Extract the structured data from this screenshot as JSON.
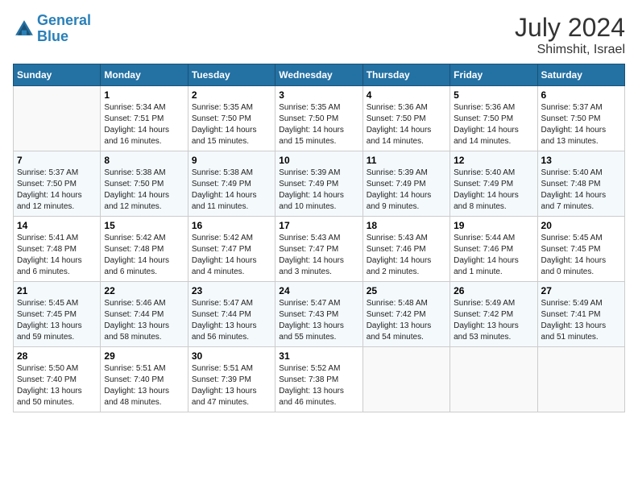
{
  "header": {
    "logo_line1": "General",
    "logo_line2": "Blue",
    "month_year": "July 2024",
    "location": "Shimshit, Israel"
  },
  "weekdays": [
    "Sunday",
    "Monday",
    "Tuesday",
    "Wednesday",
    "Thursday",
    "Friday",
    "Saturday"
  ],
  "weeks": [
    [
      {
        "day": "",
        "info": ""
      },
      {
        "day": "1",
        "info": "Sunrise: 5:34 AM\nSunset: 7:51 PM\nDaylight: 14 hours\nand 16 minutes."
      },
      {
        "day": "2",
        "info": "Sunrise: 5:35 AM\nSunset: 7:50 PM\nDaylight: 14 hours\nand 15 minutes."
      },
      {
        "day": "3",
        "info": "Sunrise: 5:35 AM\nSunset: 7:50 PM\nDaylight: 14 hours\nand 15 minutes."
      },
      {
        "day": "4",
        "info": "Sunrise: 5:36 AM\nSunset: 7:50 PM\nDaylight: 14 hours\nand 14 minutes."
      },
      {
        "day": "5",
        "info": "Sunrise: 5:36 AM\nSunset: 7:50 PM\nDaylight: 14 hours\nand 14 minutes."
      },
      {
        "day": "6",
        "info": "Sunrise: 5:37 AM\nSunset: 7:50 PM\nDaylight: 14 hours\nand 13 minutes."
      }
    ],
    [
      {
        "day": "7",
        "info": "Sunrise: 5:37 AM\nSunset: 7:50 PM\nDaylight: 14 hours\nand 12 minutes."
      },
      {
        "day": "8",
        "info": "Sunrise: 5:38 AM\nSunset: 7:50 PM\nDaylight: 14 hours\nand 12 minutes."
      },
      {
        "day": "9",
        "info": "Sunrise: 5:38 AM\nSunset: 7:49 PM\nDaylight: 14 hours\nand 11 minutes."
      },
      {
        "day": "10",
        "info": "Sunrise: 5:39 AM\nSunset: 7:49 PM\nDaylight: 14 hours\nand 10 minutes."
      },
      {
        "day": "11",
        "info": "Sunrise: 5:39 AM\nSunset: 7:49 PM\nDaylight: 14 hours\nand 9 minutes."
      },
      {
        "day": "12",
        "info": "Sunrise: 5:40 AM\nSunset: 7:49 PM\nDaylight: 14 hours\nand 8 minutes."
      },
      {
        "day": "13",
        "info": "Sunrise: 5:40 AM\nSunset: 7:48 PM\nDaylight: 14 hours\nand 7 minutes."
      }
    ],
    [
      {
        "day": "14",
        "info": "Sunrise: 5:41 AM\nSunset: 7:48 PM\nDaylight: 14 hours\nand 6 minutes."
      },
      {
        "day": "15",
        "info": "Sunrise: 5:42 AM\nSunset: 7:48 PM\nDaylight: 14 hours\nand 6 minutes."
      },
      {
        "day": "16",
        "info": "Sunrise: 5:42 AM\nSunset: 7:47 PM\nDaylight: 14 hours\nand 4 minutes."
      },
      {
        "day": "17",
        "info": "Sunrise: 5:43 AM\nSunset: 7:47 PM\nDaylight: 14 hours\nand 3 minutes."
      },
      {
        "day": "18",
        "info": "Sunrise: 5:43 AM\nSunset: 7:46 PM\nDaylight: 14 hours\nand 2 minutes."
      },
      {
        "day": "19",
        "info": "Sunrise: 5:44 AM\nSunset: 7:46 PM\nDaylight: 14 hours\nand 1 minute."
      },
      {
        "day": "20",
        "info": "Sunrise: 5:45 AM\nSunset: 7:45 PM\nDaylight: 14 hours\nand 0 minutes."
      }
    ],
    [
      {
        "day": "21",
        "info": "Sunrise: 5:45 AM\nSunset: 7:45 PM\nDaylight: 13 hours\nand 59 minutes."
      },
      {
        "day": "22",
        "info": "Sunrise: 5:46 AM\nSunset: 7:44 PM\nDaylight: 13 hours\nand 58 minutes."
      },
      {
        "day": "23",
        "info": "Sunrise: 5:47 AM\nSunset: 7:44 PM\nDaylight: 13 hours\nand 56 minutes."
      },
      {
        "day": "24",
        "info": "Sunrise: 5:47 AM\nSunset: 7:43 PM\nDaylight: 13 hours\nand 55 minutes."
      },
      {
        "day": "25",
        "info": "Sunrise: 5:48 AM\nSunset: 7:42 PM\nDaylight: 13 hours\nand 54 minutes."
      },
      {
        "day": "26",
        "info": "Sunrise: 5:49 AM\nSunset: 7:42 PM\nDaylight: 13 hours\nand 53 minutes."
      },
      {
        "day": "27",
        "info": "Sunrise: 5:49 AM\nSunset: 7:41 PM\nDaylight: 13 hours\nand 51 minutes."
      }
    ],
    [
      {
        "day": "28",
        "info": "Sunrise: 5:50 AM\nSunset: 7:40 PM\nDaylight: 13 hours\nand 50 minutes."
      },
      {
        "day": "29",
        "info": "Sunrise: 5:51 AM\nSunset: 7:40 PM\nDaylight: 13 hours\nand 48 minutes."
      },
      {
        "day": "30",
        "info": "Sunrise: 5:51 AM\nSunset: 7:39 PM\nDaylight: 13 hours\nand 47 minutes."
      },
      {
        "day": "31",
        "info": "Sunrise: 5:52 AM\nSunset: 7:38 PM\nDaylight: 13 hours\nand 46 minutes."
      },
      {
        "day": "",
        "info": ""
      },
      {
        "day": "",
        "info": ""
      },
      {
        "day": "",
        "info": ""
      }
    ]
  ]
}
